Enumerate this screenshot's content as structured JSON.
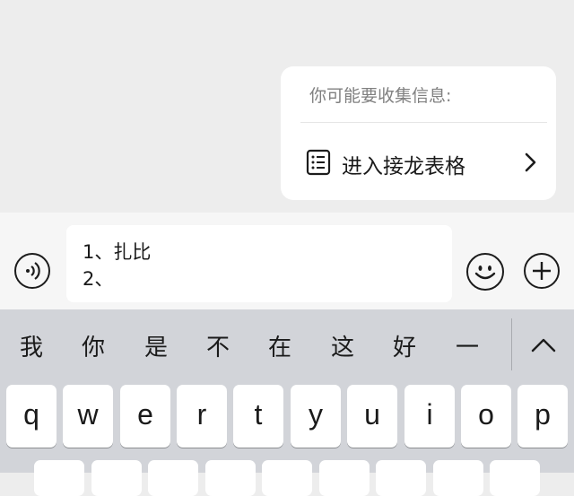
{
  "suggestion_card": {
    "title": "你可能要收集信息:",
    "action_label": "进入接龙表格"
  },
  "input": {
    "lines": [
      "1、扎比",
      "2、"
    ]
  },
  "candidates": [
    "我",
    "你",
    "是",
    "不",
    "在",
    "这",
    "好",
    "一"
  ],
  "keys_row1": [
    "q",
    "w",
    "e",
    "r",
    "t",
    "y",
    "u",
    "i",
    "o",
    "p"
  ],
  "icons": {
    "list": "list-icon",
    "chevron": "chevron-right-icon",
    "voice": "voice-icon",
    "emoji": "emoji-icon",
    "plus": "plus-icon",
    "collapse": "chevron-up-icon"
  }
}
